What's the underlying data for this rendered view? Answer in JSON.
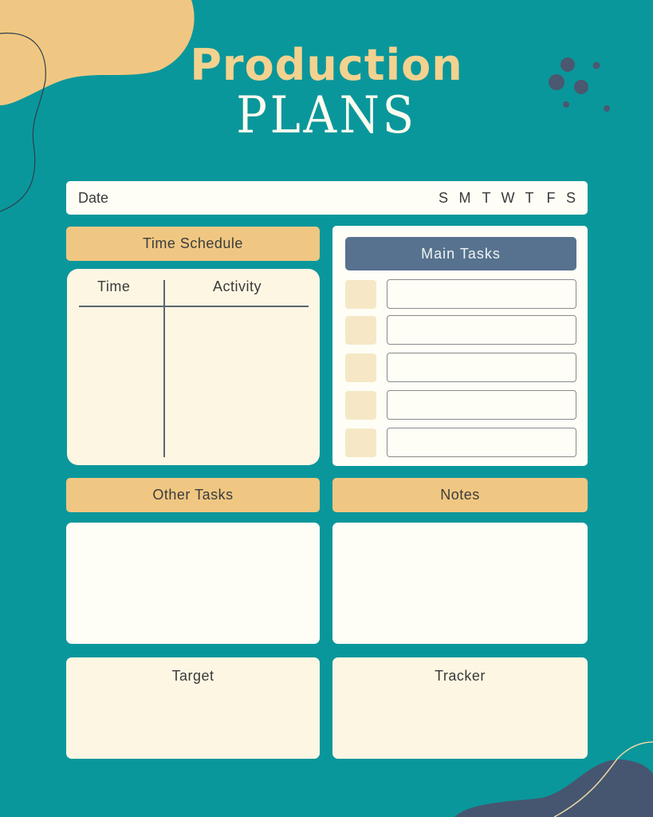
{
  "title": {
    "line1": "Production",
    "line2": "PLANS"
  },
  "date_bar": {
    "label": "Date",
    "weekdays": [
      "S",
      "M",
      "T",
      "W",
      "T",
      "F",
      "S"
    ]
  },
  "time_schedule": {
    "heading": "Time Schedule",
    "columns": [
      "Time",
      "Activity"
    ],
    "rows": []
  },
  "main_tasks": {
    "heading": "Main Tasks",
    "items": [
      {
        "checked": false,
        "text": ""
      },
      {
        "checked": false,
        "text": ""
      },
      {
        "checked": false,
        "text": ""
      },
      {
        "checked": false,
        "text": ""
      },
      {
        "checked": false,
        "text": ""
      }
    ]
  },
  "other_tasks": {
    "heading": "Other Tasks",
    "text": ""
  },
  "notes": {
    "heading": "Notes",
    "text": ""
  },
  "target": {
    "heading": "Target",
    "text": ""
  },
  "tracker": {
    "heading": "Tracker",
    "text": ""
  },
  "colors": {
    "background": "#0a979b",
    "accent_yellow": "#f0c782",
    "cream": "#fdf6e3",
    "main_tasks_header": "#57728e",
    "dark_blob": "#465670"
  }
}
